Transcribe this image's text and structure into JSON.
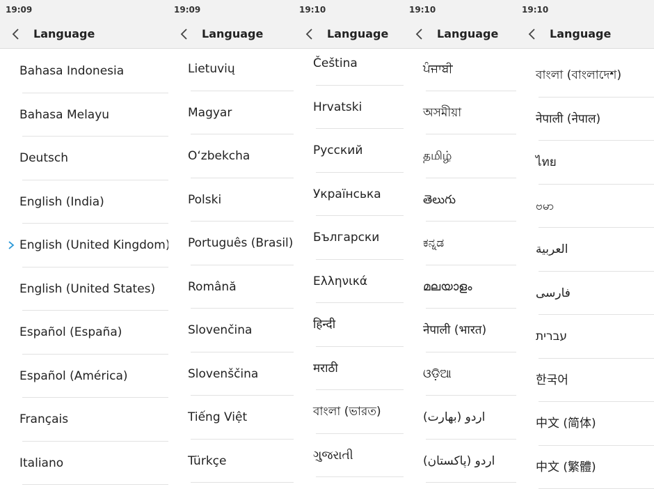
{
  "accent_color": "#2f9bd9",
  "panels": [
    {
      "time": "19:09",
      "title": "Language",
      "items": [
        "Bahasa Indonesia",
        "Bahasa Melayu",
        "Deutsch",
        "English (India)",
        "English (United Kingdom)",
        "English (United States)",
        "Español (España)",
        "Español (América)",
        "Français",
        "Italiano"
      ],
      "selected_index": 4
    },
    {
      "time": "19:09",
      "title": "Language",
      "items": [
        "Lietuvių",
        "Magyar",
        "O‘zbekcha",
        "Polski",
        "Português (Brasil)",
        "Română",
        "Slovenčina",
        "Slovenščina",
        "Tiếng Việt",
        "Türkçe"
      ]
    },
    {
      "time": "19:10",
      "title": "Language",
      "items": [
        "Čeština",
        "Hrvatski",
        "Русский",
        "Українська",
        "Български",
        "Ελληνικά",
        "हिन्दी",
        "मराठी",
        "বাংলা (ভারত)",
        "ગુજરાતી"
      ]
    },
    {
      "time": "19:10",
      "title": "Language",
      "items": [
        "ਪੰਜਾਬੀ",
        "অসমীয়া",
        "தமிழ்",
        "తెలుగు",
        "ಕನ್ನಡ",
        "മലയാളം",
        "नेपाली (भारत)",
        "ଓଡ଼ିଆ",
        "اردو (بھارت)",
        "اردو (پاکستان)"
      ]
    },
    {
      "time": "19:10",
      "title": "Language",
      "items": [
        "বাংলা (বাংলাদেশ)",
        "नेपाली (नेपाल)",
        "ไทย",
        "ဗမာ",
        "العربية",
        "فارسی",
        "עברית",
        "한국어",
        "中文 (简体)",
        "中文 (繁體)"
      ]
    }
  ]
}
